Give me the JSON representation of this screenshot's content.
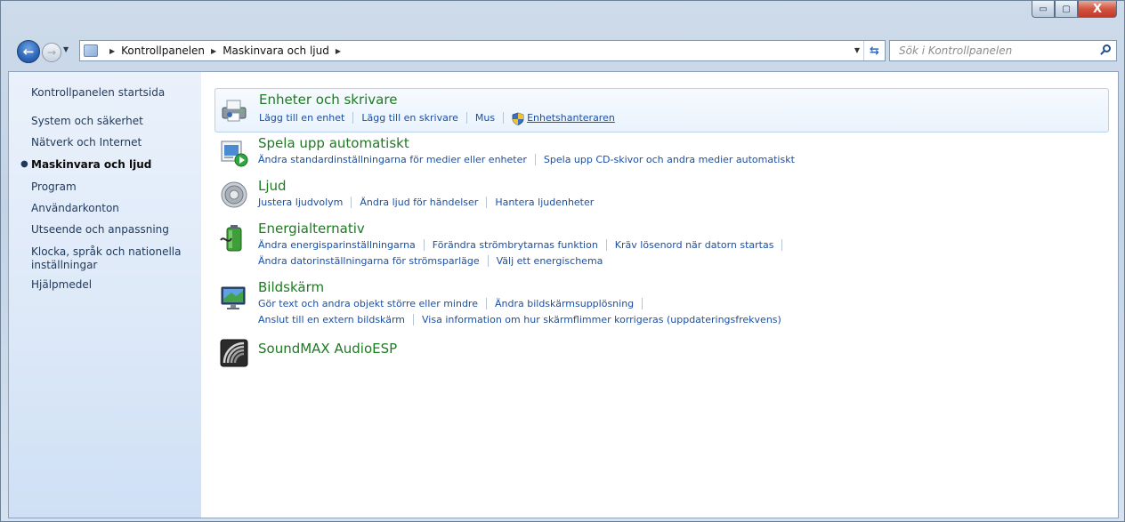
{
  "window": {
    "caption_minimize": "▭",
    "caption_maximize": "▢",
    "caption_close": "X"
  },
  "address": {
    "crumbs": [
      "Kontrollpanelen",
      "Maskinvara och ljud"
    ],
    "search_placeholder": "Sök i Kontrollpanelen"
  },
  "sidebar": {
    "items": [
      {
        "label": "Kontrollpanelen startsida"
      },
      {
        "label": "System och säkerhet"
      },
      {
        "label": "Nätverk och Internet"
      },
      {
        "label": "Maskinvara och ljud",
        "selected": true
      },
      {
        "label": "Program"
      },
      {
        "label": "Användarkonton"
      },
      {
        "label": "Utseende och anpassning"
      },
      {
        "label": "Klocka, språk och nationella inställningar"
      },
      {
        "label": "Hjälpmedel"
      }
    ]
  },
  "categories": [
    {
      "title": "Enheter och skrivare",
      "icon": "printer-icon",
      "links": [
        "Lägg till en enhet",
        "Lägg till en skrivare",
        "Mus",
        "Enhetshanteraren"
      ]
    },
    {
      "title": "Spela upp automatiskt",
      "icon": "autoplay-icon",
      "links": [
        "Ändra standardinställningarna för medier eller enheter",
        "Spela upp CD-skivor och andra medier automatiskt"
      ]
    },
    {
      "title": "Ljud",
      "icon": "speaker-icon",
      "links": [
        "Justera ljudvolym",
        "Ändra ljud för händelser",
        "Hantera ljudenheter"
      ]
    },
    {
      "title": "Energialternativ",
      "icon": "battery-icon",
      "links": [
        "Ändra energisparinställningarna",
        "Förändra strömbrytarnas funktion",
        "Kräv lösenord när datorn startas"
      ],
      "links2": [
        "Ändra datorinställningarna för strömsparläge",
        "Välj ett energischema"
      ]
    },
    {
      "title": "Bildskärm",
      "icon": "monitor-icon",
      "links": [
        "Gör text och andra objekt större eller mindre",
        "Ändra bildskärmsupplösning"
      ],
      "links2": [
        "Anslut till en extern bildskärm",
        "Visa information om hur skärmflimmer korrigeras (uppdateringsfrekvens)"
      ]
    },
    {
      "title": "SoundMAX AudioESP",
      "icon": "soundmax-icon"
    }
  ],
  "colors": {
    "category_title": "#1e7a22",
    "link": "#1c4fa3"
  }
}
